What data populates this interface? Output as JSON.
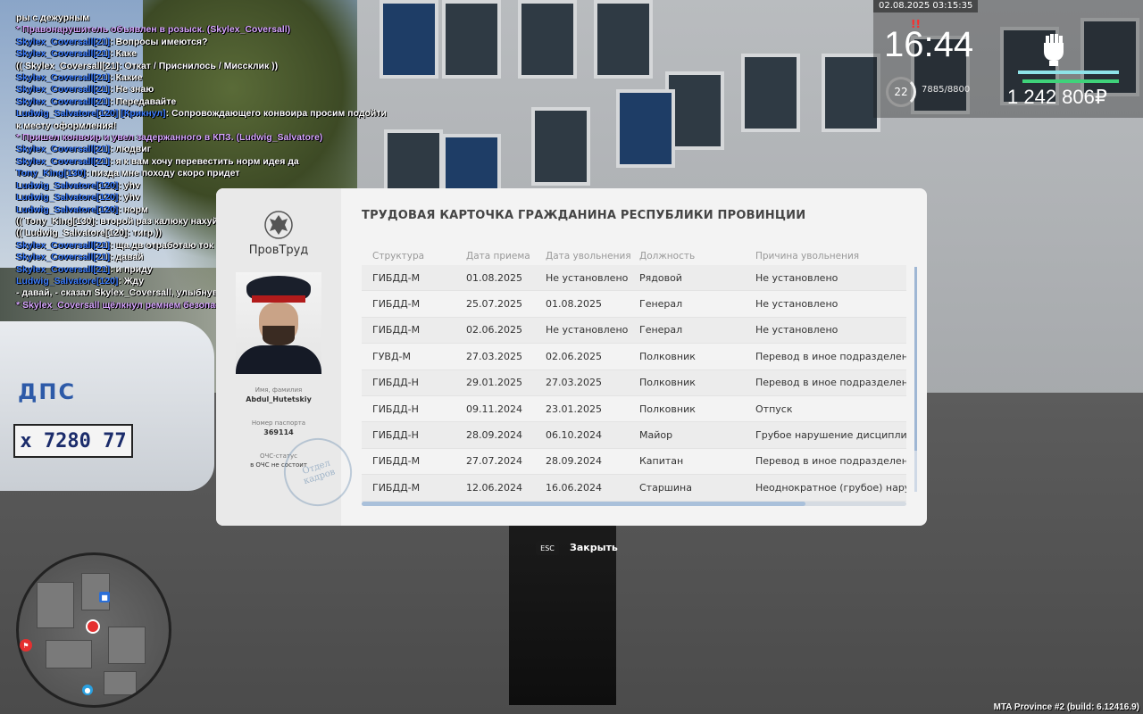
{
  "chat": [
    {
      "parts": [
        {
          "t": "ры с дежурным",
          "c": "white"
        }
      ]
    },
    {
      "parts": [
        {
          "t": " * Правонарушитель объявлен в розыск. (Skylex_Coversall)",
          "c": "purple"
        }
      ]
    },
    {
      "parts": [
        {
          "t": "Skylex_Coversall[21]",
          "c": "name"
        },
        {
          "t": ": Вопросы имеются?",
          "c": "white"
        }
      ]
    },
    {
      "parts": [
        {
          "t": "Skylex_Coversall[21]",
          "c": "name"
        },
        {
          "t": ": Каке",
          "c": "white"
        }
      ]
    },
    {
      "parts": [
        {
          "t": "(( Skylex_Coversall[21]: Откат / Приснилось / Миссклик ))",
          "c": "white"
        }
      ]
    },
    {
      "parts": [
        {
          "t": "Skylex_Coversall[21]",
          "c": "name"
        },
        {
          "t": ": Какие",
          "c": "white"
        }
      ]
    },
    {
      "parts": [
        {
          "t": "Skylex_Coversall[21]",
          "c": "name"
        },
        {
          "t": ": Не знаю",
          "c": "white"
        }
      ]
    },
    {
      "parts": [
        {
          "t": "Skylex_Coversall[21]",
          "c": "name"
        },
        {
          "t": ": Передавайте",
          "c": "white"
        }
      ]
    },
    {
      "parts": [
        {
          "t": "Ludwig_Salvatore[120] [Крикнул]",
          "c": "name"
        },
        {
          "t": ": Сопровождающего конвоира просим подойти",
          "c": "white"
        }
      ]
    },
    {
      "parts": [
        {
          "t": "к месту оформления!",
          "c": "white"
        }
      ]
    },
    {
      "parts": [
        {
          "t": " * Пришел конвоир и увел задержанного в КПЗ. (Ludwig_Salvatore)",
          "c": "purple"
        }
      ]
    },
    {
      "parts": [
        {
          "t": "Skylex_Coversall[21]",
          "c": "name"
        },
        {
          "t": ": людвиг",
          "c": "white"
        }
      ]
    },
    {
      "parts": [
        {
          "t": "Skylex_Coversall[21]",
          "c": "name"
        },
        {
          "t": ": я к вам хочу перевестить норм идея да",
          "c": "white"
        }
      ]
    },
    {
      "parts": [
        {
          "t": "Tony_King[130]",
          "c": "name"
        },
        {
          "t": ": пизда мне походу скоро придет",
          "c": "white"
        }
      ]
    },
    {
      "parts": [
        {
          "t": "Ludwig_Salvatore[120]",
          "c": "name"
        },
        {
          "t": ": yhv",
          "c": "white"
        }
      ]
    },
    {
      "parts": [
        {
          "t": "Ludwig_Salvatore[120]",
          "c": "name"
        },
        {
          "t": ": yhv",
          "c": "white"
        }
      ]
    },
    {
      "parts": [
        {
          "t": "Ludwig_Salvatore[120]",
          "c": "name"
        },
        {
          "t": ": норм",
          "c": "white"
        }
      ]
    },
    {
      "parts": [
        {
          "t": "(( Tony_King[130]: второй раз калюку нахуй шлю ))",
          "c": "white"
        }
      ]
    },
    {
      "parts": [
        {
          "t": "(( Ludwig_Salvatore[120]: тигр ))",
          "c": "white"
        }
      ]
    },
    {
      "parts": [
        {
          "t": "Skylex_Coversall[21]",
          "c": "name"
        },
        {
          "t": ": ща дв отработаю ток",
          "c": "white"
        }
      ]
    },
    {
      "parts": [
        {
          "t": "Skylex_Coversall[21]",
          "c": "name"
        },
        {
          "t": ": давай",
          "c": "white"
        }
      ]
    },
    {
      "parts": [
        {
          "t": "Skylex_Coversall[21]",
          "c": "name"
        },
        {
          "t": ": и приду",
          "c": "white"
        }
      ]
    },
    {
      "parts": [
        {
          "t": "Ludwig_Salvatore[120]",
          "c": "name"
        },
        {
          "t": ": Жду",
          "c": "white"
        }
      ]
    },
    {
      "parts": [
        {
          "t": "- давай, - сказал Skylex_Coversall, улыбнувшись.",
          "c": "white"
        }
      ]
    },
    {
      "parts": [
        {
          "t": " * Skylex_Coversall щёлкнул ремнем безопасности",
          "c": "purple"
        }
      ]
    }
  ],
  "hud": {
    "date": "02.08.2025 03:15:35",
    "time": "16:44",
    "red_mark": "!!",
    "level": "22",
    "xp": "7885/8800",
    "money": "1 242 806₽"
  },
  "car": {
    "label": "ДПС",
    "plate": "х 7280 77"
  },
  "card": {
    "title": "ТРУДОВАЯ КАРТОЧКА ГРАЖДАНИНА РЕСПУБЛИКИ ПРОВИНЦИИ",
    "brand": "ПровТруд",
    "name_label": "Имя, фамилия",
    "name_value": "Abdul_Hutetskiy",
    "passport_label": "Номер паспорта",
    "passport_value": "369114",
    "ochs_label": "ОЧС-статус",
    "ochs_value": "в ОЧС не состоит",
    "stamp_line1": "Отдел",
    "stamp_line2": "кадров",
    "headers": [
      "Структура",
      "Дата приема",
      "Дата увольнения",
      "Должность",
      "Причина увольнения"
    ],
    "rows": [
      [
        "ГИБДД-М",
        "01.08.2025",
        "Не установлено",
        "Рядовой",
        "Не установлено"
      ],
      [
        "ГИБДД-М",
        "25.07.2025",
        "01.08.2025",
        "Генерал",
        "Не установлено"
      ],
      [
        "ГИБДД-М",
        "02.06.2025",
        "Не установлено",
        "Генерал",
        "Не установлено"
      ],
      [
        "ГУВД-М",
        "27.03.2025",
        "02.06.2025",
        "Полковник",
        "Перевод в иное подразделение"
      ],
      [
        "ГИБДД-Н",
        "29.01.2025",
        "27.03.2025",
        "Полковник",
        "Перевод в иное подразделение"
      ],
      [
        "ГИБДД-Н",
        "09.11.2024",
        "23.01.2025",
        "Полковник",
        "Отпуск"
      ],
      [
        "ГИБДД-Н",
        "28.09.2024",
        "06.10.2024",
        "Майор",
        "Грубое нарушение дисциплины"
      ],
      [
        "ГИБДД-М",
        "27.07.2024",
        "28.09.2024",
        "Капитан",
        "Перевод в иное подразделение"
      ],
      [
        "ГИБДД-М",
        "12.06.2024",
        "16.06.2024",
        "Старшина",
        "Неоднократное (грубое) нарушение"
      ]
    ]
  },
  "close": {
    "key": "ESC",
    "label": "Закрыть"
  },
  "build": "MTA Province #2 (build: 6.12416.9)",
  "icons": {
    "hud_emblem": "fist-icon",
    "emblem": "eagle-emblem-icon",
    "map_player": "player-marker-icon"
  }
}
